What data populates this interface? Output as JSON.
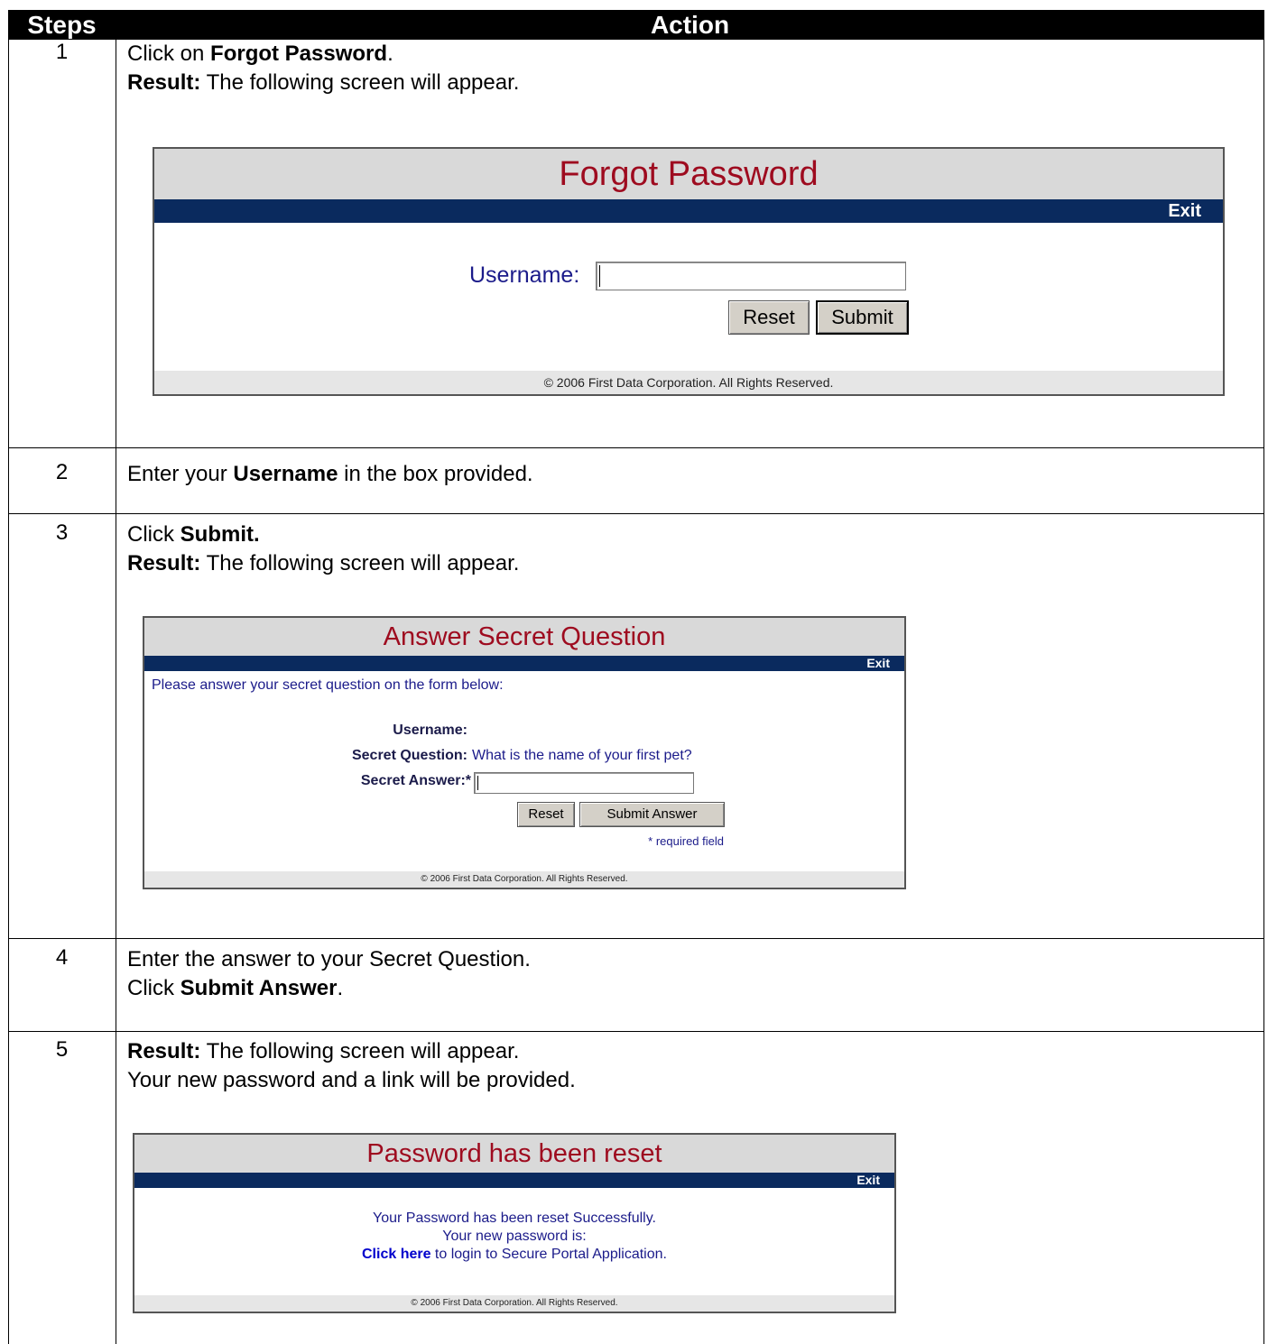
{
  "header": {
    "steps": "Steps",
    "action": "Action"
  },
  "step1": {
    "num": "1",
    "line1_pre": "Click on ",
    "line1_bold": "Forgot Password",
    "line1_post": ".",
    "line2_bold": "Result:",
    "line2_rest": " The following screen will appear.",
    "screen": {
      "title": "Forgot Password",
      "exit": "Exit",
      "username_label": "Username:",
      "reset": "Reset",
      "submit": "Submit",
      "footer": "© 2006 First Data Corporation. All Rights Reserved."
    }
  },
  "step2": {
    "num": "2",
    "pre": "Enter your ",
    "bold": "Username",
    "post": " in the box provided."
  },
  "step3": {
    "num": "3",
    "line1_pre": "Click ",
    "line1_bold": "Submit.",
    "line2_bold": "Result:",
    "line2_rest": " The following screen will appear.",
    "screen": {
      "title": "Answer Secret Question",
      "exit": "Exit",
      "intro": "Please answer your secret question on the form below:",
      "username_label": "Username:",
      "question_label": "Secret Question:",
      "question_value": "What is the name of your first pet?",
      "answer_label": "Secret Answer:*",
      "reset": "Reset",
      "submit": "Submit Answer",
      "required_note": "* required field",
      "footer": "© 2006 First Data Corporation. All Rights Reserved."
    }
  },
  "step4": {
    "num": "4",
    "line1": "Enter the answer to your Secret Question.",
    "line2_pre": "Click ",
    "line2_bold": "Submit Answer",
    "line2_post": "."
  },
  "step5": {
    "num": "5",
    "line1_bold": "Result:",
    "line1_rest": " The following screen will appear.",
    "line2": "Your new password and a link will be provided.",
    "screen": {
      "title": "Password has been reset",
      "exit": "Exit",
      "msg1": "Your Password has been reset Successfully.",
      "msg2": "Your new password is:",
      "link": "Click here",
      "msg3_rest": " to login to Secure Portal Application.",
      "footer": "© 2006 First Data Corporation. All Rights Reserved."
    }
  },
  "colors": {
    "title_red": "#9e0b1f",
    "bar_navy": "#0a2a5e",
    "label_blue": "#1b1b8a",
    "link_blue": "#0000cc"
  }
}
